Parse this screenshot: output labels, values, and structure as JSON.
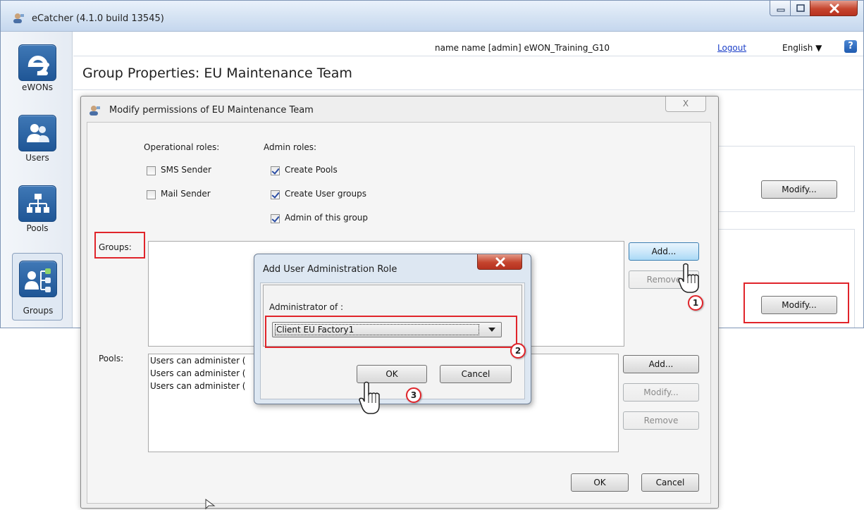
{
  "window": {
    "title": "eCatcher (4.1.0 build 13545)"
  },
  "sidebar": {
    "items": [
      {
        "label": "eWONs",
        "icon": "ewon-logo-icon"
      },
      {
        "label": "Users",
        "icon": "users-icon"
      },
      {
        "label": "Pools",
        "icon": "pools-icon"
      },
      {
        "label": "Groups",
        "icon": "groups-icon",
        "active": true
      }
    ]
  },
  "header": {
    "user_info": "name name [admin] eWON_Training_G10",
    "logout": "Logout",
    "language": "English ▼",
    "help": "?"
  },
  "page": {
    "title": "Group Properties: EU Maintenance Team"
  },
  "right_panel": {
    "modify1": "Modify...",
    "modify2": "Modify..."
  },
  "modal": {
    "title": "Modify permissions of EU Maintenance Team",
    "close": "X",
    "operational_label": "Operational roles:",
    "admin_label": "Admin roles:",
    "operational_roles": [
      {
        "label": "SMS Sender",
        "checked": false
      },
      {
        "label": "Mail Sender",
        "checked": false
      }
    ],
    "admin_roles": [
      {
        "label": "Create Pools",
        "checked": true
      },
      {
        "label": "Create User groups",
        "checked": true
      },
      {
        "label": "Admin of this group",
        "checked": true
      }
    ],
    "groups_label": "Groups:",
    "groups_add": "Add...",
    "groups_remove": "Remove",
    "pools_label": "Pools:",
    "pools_items": [
      "Users can administer (",
      "Users can administer (",
      "Users can administer ("
    ],
    "pools_add": "Add...",
    "pools_modify": "Modify...",
    "pools_remove": "Remove",
    "ok": "OK",
    "cancel": "Cancel"
  },
  "inner_dialog": {
    "title": "Add User Administration Role",
    "admin_of_label": "Administrator of :",
    "selected": "Client EU Factory1",
    "ok": "OK",
    "cancel": "Cancel"
  },
  "annotations": {
    "step1": "1",
    "step2": "2",
    "step3": "3",
    "highlight_color": "#e0242a"
  }
}
